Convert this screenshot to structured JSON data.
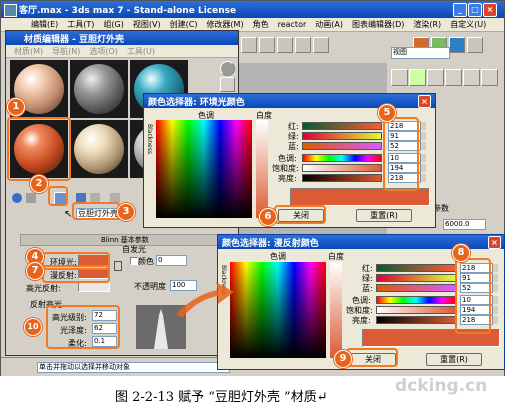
{
  "main_window": {
    "title": "客厅.max - 3ds max 7 - Stand-alone License",
    "menu": [
      "编辑(E)",
      "工具(T)",
      "组(G)",
      "视图(V)",
      "创建(C)",
      "修改器(M)",
      "角色",
      "reactor",
      "动画(A)",
      "图表编辑器(D)",
      "渲染(R)",
      "自定义(U)",
      "MAXScript(M)"
    ],
    "view_dropdown": "视图",
    "params_label": "参数",
    "param_value": "6000.0",
    "status_text": "单击并拖动以选择并移动对象"
  },
  "material_editor": {
    "title": "材质编辑器 - 豆胆灯外壳",
    "menu": [
      "材质(M)",
      "导航(N)",
      "选项(O)",
      "工具(U)"
    ],
    "material_name": "豆胆灯外壳",
    "shader_rollout": "Blinn 基本参数",
    "self_illum": "自发光",
    "color_label": "颜色",
    "color_value": "0",
    "opacity_label": "不透明度",
    "opacity_value": "100",
    "ambient_label": "环境光:",
    "diffuse_label": "漫反射:",
    "specular_label": "高光反射:",
    "highlight_group": "反射高光",
    "spec_level_label": "高光级别:",
    "spec_level_value": "72",
    "gloss_label": "光泽度:",
    "gloss_value": "62",
    "soften_label": "柔化:",
    "soften_value": "0.1"
  },
  "color_picker_ambient": {
    "title": "颜色选择器: 环境光颜色",
    "hue_label": "色调",
    "white_label": "白度",
    "black_label": "Blackness",
    "rows": [
      {
        "label": "红:",
        "value": "218"
      },
      {
        "label": "绿:",
        "value": "91"
      },
      {
        "label": "蓝:",
        "value": "52"
      },
      {
        "label": "色调:",
        "value": "10"
      },
      {
        "label": "饱和度:",
        "value": "194"
      },
      {
        "label": "亮度:",
        "value": "218"
      }
    ],
    "close_label": "关闭",
    "reset_label": "重置(R)",
    "swatch_color": "#da5b34"
  },
  "color_picker_diffuse": {
    "title": "颜色选择器: 漫反射颜色",
    "hue_label": "色调",
    "white_label": "白度",
    "black_label": "Blackness",
    "rows": [
      {
        "label": "红:",
        "value": "218"
      },
      {
        "label": "绿:",
        "value": "91"
      },
      {
        "label": "蓝:",
        "value": "52"
      },
      {
        "label": "色调:",
        "value": "10"
      },
      {
        "label": "饱和度:",
        "value": "194"
      },
      {
        "label": "亮度:",
        "value": "218"
      }
    ],
    "close_label": "关闭",
    "reset_label": "重置(R)",
    "swatch_color": "#da5b34"
  },
  "markers": [
    "1",
    "2",
    "3",
    "4",
    "5",
    "6",
    "7",
    "8",
    "9",
    "10"
  ],
  "caption": "图 2-2-13   赋予 “豆胆灯外壳 ”材质↵",
  "watermark": "dcking.cn",
  "colors": {
    "accent": "#f07a25",
    "title_blue": "#0b47b7",
    "material": "#da5b34"
  }
}
